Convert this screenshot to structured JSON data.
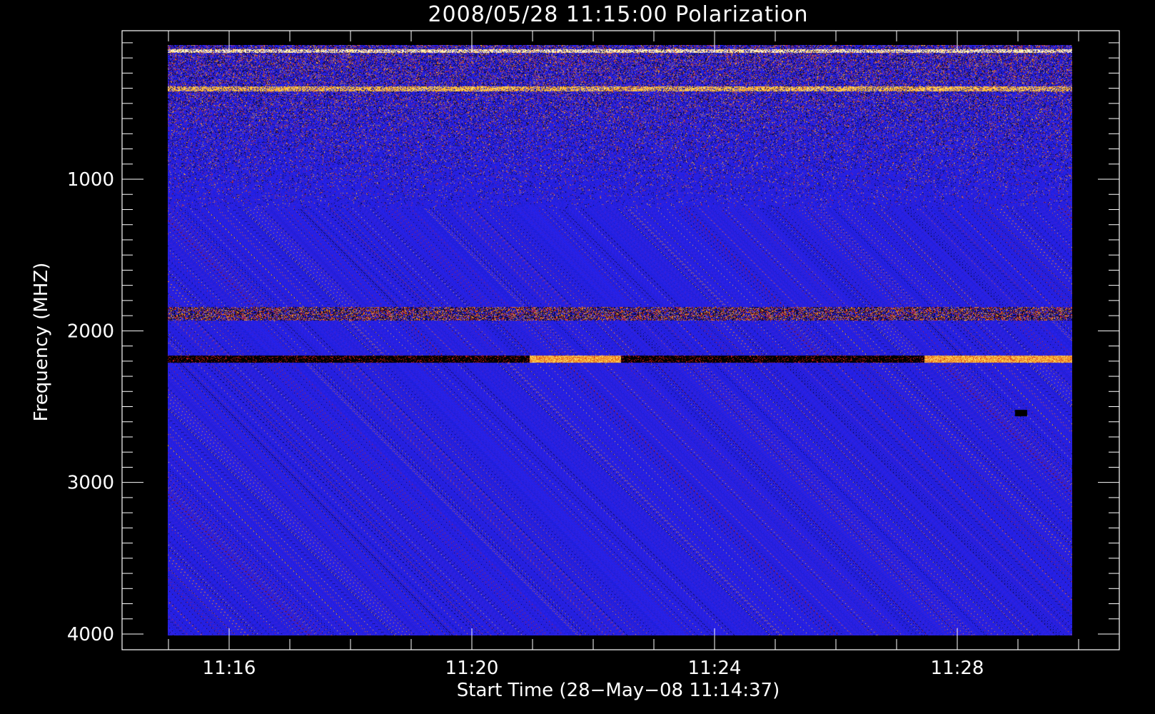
{
  "chart_data": {
    "type": "heatmap",
    "title": "2008/05/28 11:15:00 Polarization",
    "xlabel": "Start Time (28−May−08 11:14:37)",
    "ylabel": "Frequency (MHZ)",
    "x_time_range": [
      "11:14:37",
      "11:30:00"
    ],
    "y_range": [
      4000,
      100
    ],
    "y_inverted": true,
    "x_ticks": [
      "11:16",
      "11:20",
      "11:24",
      "11:28"
    ],
    "y_ticks": [
      {
        "value": 1000,
        "label": "1000"
      },
      {
        "value": 2000,
        "label": "2000"
      },
      {
        "value": 3000,
        "label": "3000"
      },
      {
        "value": 4000,
        "label": "4000"
      }
    ],
    "colormap": [
      "#000000",
      "#2222f2",
      "#cc1a1a",
      "#ffcc33",
      "#ffffff"
    ],
    "background_value_color": "#2222f2",
    "features": [
      {
        "name": "strong band",
        "freq_mhz": [
          2160,
          2210
        ],
        "time": "whole span",
        "state": "black low, bright between 11:21 and 11:22:30 and after 11:27:30"
      },
      {
        "name": "band",
        "freq_mhz": [
          1840,
          1930
        ],
        "time": "whole span",
        "state": "mixed red/yellow/black"
      },
      {
        "name": "bright line",
        "freq_mhz": [
          140,
          160
        ],
        "time": "whole span",
        "state": "white/yellow"
      },
      {
        "name": "bright line",
        "freq_mhz": [
          380,
          420
        ],
        "time": "whole span",
        "state": "yellow/red"
      },
      {
        "name": "speckle region",
        "freq_mhz": [
          100,
          1200
        ],
        "time": "whole span",
        "state": "noisy red/black"
      },
      {
        "name": "spot",
        "freq_mhz": [
          2520,
          2560
        ],
        "time": "11:29:10",
        "state": "black"
      }
    ]
  }
}
